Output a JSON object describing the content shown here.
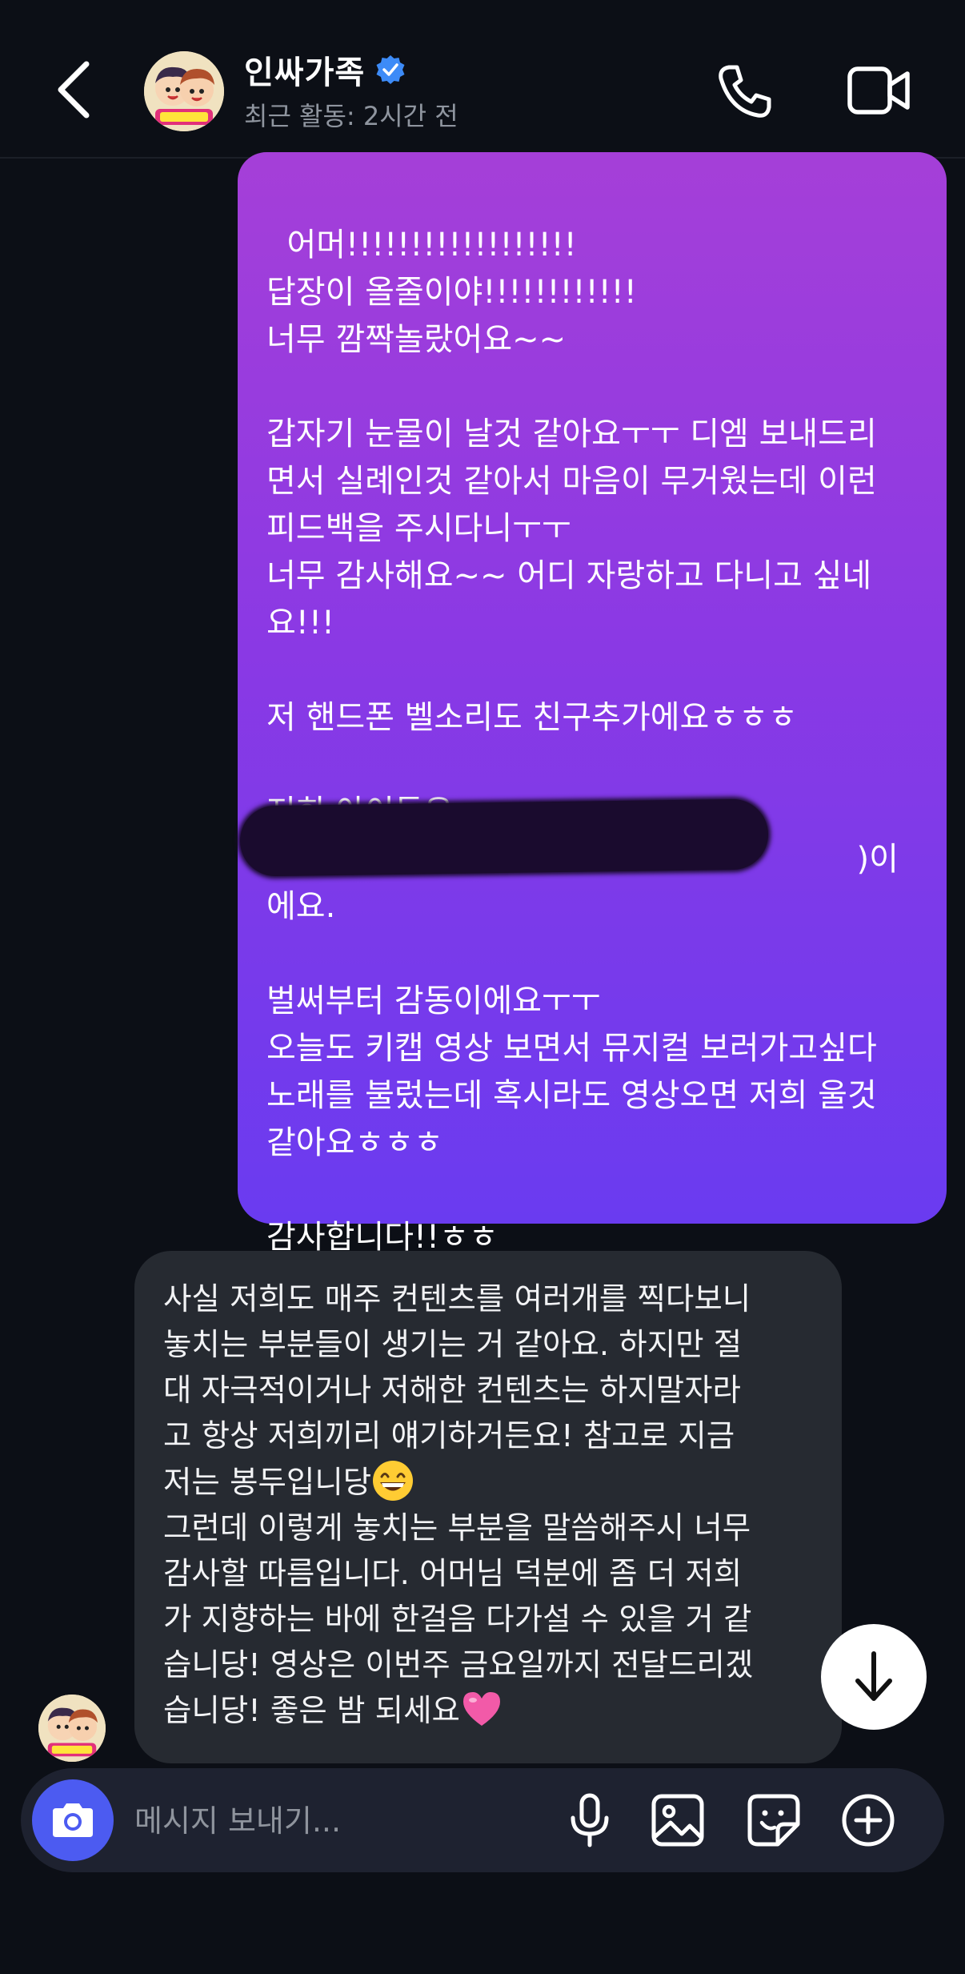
{
  "header": {
    "title": "인싸가족",
    "subtitle": "최근 활동: 2시간 전"
  },
  "messages": {
    "outgoing_text": "어머!!!!!!!!!!!!!!!!!!\n답장이 올줄이야!!!!!!!!!!!!\n너무 깜짝놀랐어요~~\n\n갑자기 눈물이 날것 같아요ㅜㅜ 디엠 보내드리\n면서 실례인것 같아서 마음이 무거웠는데 이런\n피드백을 주시다니ㅜㅜ\n너무 감사해요~~ 어디 자랑하고 다니고 싶네\n요!!!\n\n저 핸드폰 벨소리도 친구추가에요ㅎㅎㅎ\n\n저희 아이들은\n                                                          )이에요.\n\n벌써부터 감동이에요ㅜㅜ\n오늘도 키캡 영상 보면서 뮤지컬 보러가고싶다\n노래를 불렀는데 혹시라도 영상오면 저희 울것\n같아요ㅎㅎㅎ\n\n감사합니다!!ㅎㅎ",
    "incoming_part1": "사실 저희도 매주 컨텐츠를 여러개를 찍다보니\n놓치는 부분들이 생기는 거 같아요. 하지만 절\n대 자극적이거나 저해한 컨텐츠는 하지말자라\n고 항상 저희끼리 얘기하거든요! 참고로 지금\n저는 봉두입니당",
    "incoming_part2": "\n그런데 이렇게 놓치는 부분을 말씀해주시 너무\n감사할 따름입니다. 어머님 덕분에 좀 더 저희\n가 지향하는 바에 한걸음 다가설 수 있을 거 같\n습니당! 영상은 이번주 금요일까지 전달드리겠\n습니당! 좋은 밤 되세요"
  },
  "composer": {
    "placeholder": "메시지 보내기..."
  },
  "icons": {
    "back": "chevron-left-icon",
    "verified": "verified-badge-icon",
    "call": "phone-icon",
    "video": "video-camera-icon",
    "scroll": "arrow-down-icon",
    "camera": "camera-icon",
    "mic": "microphone-icon",
    "gallery": "image-icon",
    "sticker": "sticker-icon",
    "plus": "plus-circle-icon"
  },
  "colors": {
    "background": "#0c0f16",
    "outgoing_gradient_top": "#a53fd8",
    "outgoing_gradient_bottom": "#6a3bf0",
    "incoming_bubble": "#262a31",
    "camera_button": "#4c5bf1",
    "verified_badge": "#3d8bf7"
  }
}
